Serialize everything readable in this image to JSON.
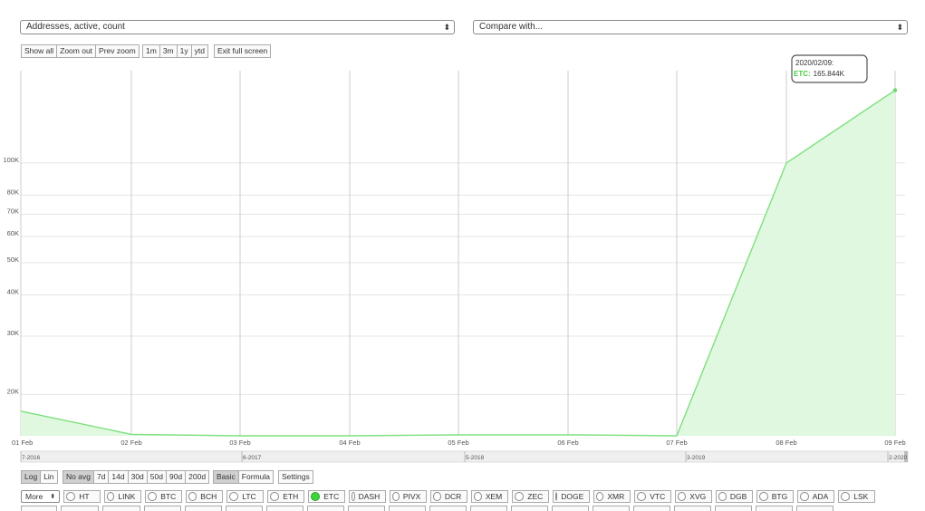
{
  "selectors": {
    "metric": "Addresses, active, count",
    "compare": "Compare with..."
  },
  "zoom_buttons": [
    "Show all",
    "Zoom out",
    "Prev zoom"
  ],
  "range_buttons": [
    "1m",
    "3m",
    "1y",
    "ytd"
  ],
  "fullscreen_button": "Exit full screen",
  "scale_buttons": [
    "Log",
    "Lin"
  ],
  "scale_active": "Log",
  "avg_buttons": [
    "No avg",
    "7d",
    "14d",
    "30d",
    "50d",
    "90d",
    "200d"
  ],
  "avg_active": "No avg",
  "mode_buttons": [
    "Basic",
    "Formula"
  ],
  "mode_active": "Basic",
  "settings_button": "Settings",
  "more_select": "More",
  "coins": [
    "HT",
    "LINK",
    "BTC",
    "BCH",
    "LTC",
    "ETH",
    "ETC",
    "DASH",
    "PIVX",
    "DCR",
    "XEM",
    "ZEC",
    "DOGE",
    "XMR",
    "VTC",
    "XVG",
    "DGB",
    "BTG",
    "ADA",
    "LSK"
  ],
  "selected_coin": "ETC",
  "colors": {
    "line": "#7ee07e",
    "fill": "#dff8df",
    "marker": "#6fd66f",
    "tooltip_series": "#44cc44",
    "grid": "#cccccc"
  },
  "tooltip": {
    "date": "2020/02/09:",
    "series": "ETC:",
    "value": "165.844K"
  },
  "chart_data": {
    "type": "area",
    "series": [
      {
        "name": "ETC",
        "x": [
          "2016-02-01",
          "2017-02-01",
          "2018-02-01",
          "2019-02-01",
          "2020-02-09"
        ],
        "y": [
          17800,
          15000,
          15100,
          15000,
          165844
        ]
      }
    ],
    "y_scale": "log",
    "y_ticks": [
      "20K",
      "30K",
      "40K",
      "50K",
      "60K",
      "70K",
      "80K",
      "100K"
    ],
    "y_tick_values": [
      20000,
      30000,
      40000,
      50000,
      60000,
      70000,
      80000,
      100000
    ],
    "ylim": [
      15000,
      190000
    ],
    "grid": true,
    "x_ticks": [
      "01 Feb",
      "02 Feb",
      "03 Feb",
      "04 Feb",
      "05 Feb",
      "06 Feb",
      "07 Feb",
      "08 Feb",
      "09 Feb"
    ],
    "points": [
      {
        "date": "2016-02-01",
        "value": 17800
      },
      {
        "date": "2016-08-01",
        "value": 15150
      },
      {
        "date": "2017-02-01",
        "value": 15000
      },
      {
        "date": "2017-08-01",
        "value": 15000
      },
      {
        "date": "2018-02-01",
        "value": 15100
      },
      {
        "date": "2018-08-01",
        "value": 15100
      },
      {
        "date": "2019-02-01",
        "value": 15000
      },
      {
        "date": "2019-08-01",
        "value": 100000
      },
      {
        "date": "2020-02-09",
        "value": 165844
      }
    ],
    "navigator_ticks": [
      "7-2016",
      "6-2017",
      "5-2018",
      "3-2019",
      "2-2020"
    ]
  }
}
